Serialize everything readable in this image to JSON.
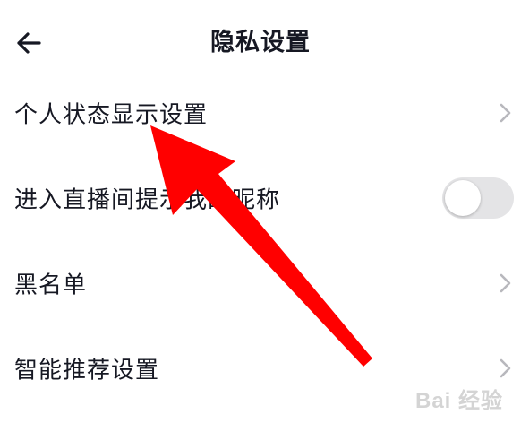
{
  "header": {
    "title": "隐私设置",
    "back_icon": "arrow-left-icon"
  },
  "settings": [
    {
      "label": "个人状态显示设置",
      "control": "chevron"
    },
    {
      "label": "进入直播间提示我的昵称",
      "control": "toggle",
      "toggle_on": false
    },
    {
      "label": "黑名单",
      "control": "chevron"
    },
    {
      "label": "智能推荐设置",
      "control": "chevron"
    }
  ],
  "annotation": {
    "arrow_color": "#ff0000"
  },
  "watermark": {
    "text": "Bai 经验"
  },
  "colors": {
    "text": "#161823",
    "chevron": "#b8b8bd",
    "toggle_off": "#e4e4e6"
  }
}
